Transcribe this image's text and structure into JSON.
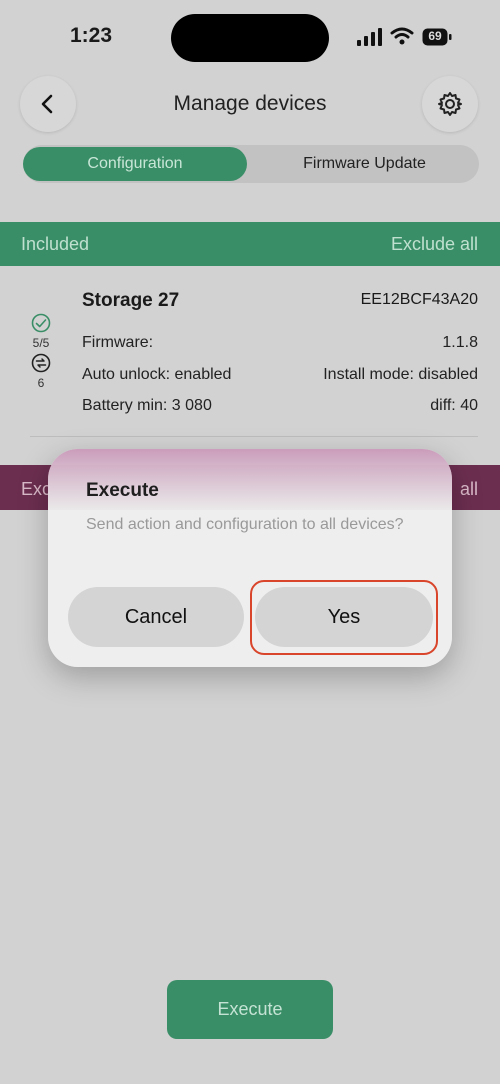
{
  "status_bar": {
    "time": "1:23",
    "battery": "69"
  },
  "header": {
    "title": "Manage devices"
  },
  "tabs": [
    {
      "label": "Configuration",
      "active": true
    },
    {
      "label": "Firmware Update",
      "active": false
    }
  ],
  "included": {
    "label": "Included",
    "action": "Exclude all"
  },
  "device": {
    "name": "Storage 27",
    "id": "EE12BCF43A20",
    "status_count": "5/5",
    "sync_count": "6",
    "rows": [
      {
        "left": "Firmware:",
        "right": "1.1.8"
      },
      {
        "left": "Auto unlock: enabled",
        "right": "Install mode: disabled"
      },
      {
        "left": "Battery min: 3 080",
        "right": "diff: 40"
      }
    ]
  },
  "excluded": {
    "label_visible": "Exc",
    "action_visible": "all"
  },
  "dialog": {
    "title": "Execute",
    "message": "Send action and configuration to all devices?",
    "cancel_label": "Cancel",
    "confirm_label": "Yes"
  },
  "footer": {
    "execute_label": "Execute"
  },
  "colors": {
    "accent": "#3a8e67",
    "excluded": "#6c2e4f",
    "highlight": "#d9452b"
  }
}
